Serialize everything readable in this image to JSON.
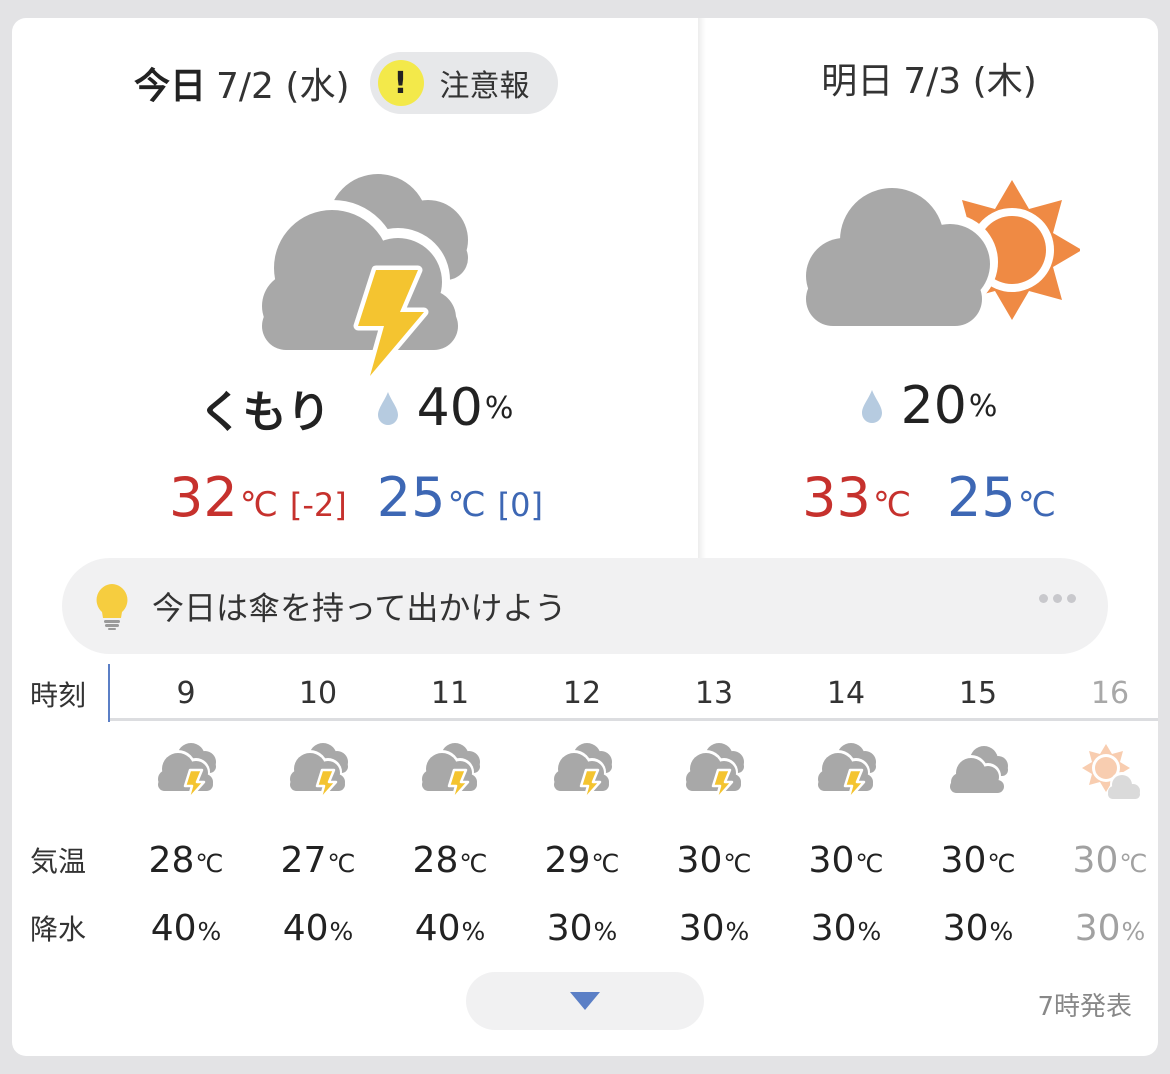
{
  "today": {
    "label": "今日",
    "date": "7/2 (水)",
    "warning_label": "注意報",
    "warning_icon": "!",
    "condition": "くもり",
    "precip_value": "40",
    "precip_unit": "%",
    "high": "32",
    "high_unit": "℃",
    "high_diff": "[-2]",
    "low": "25",
    "low_unit": "℃",
    "low_diff": "[0]",
    "icon": "cloud-thunder-icon"
  },
  "tomorrow": {
    "label": "明日",
    "date": "7/3 (木)",
    "precip_value": "20",
    "precip_unit": "%",
    "high": "33",
    "high_unit": "℃",
    "low": "25",
    "low_unit": "℃",
    "icon": "cloud-sun-icon"
  },
  "tip": {
    "text": "今日は傘を持って出かけよう",
    "icon": "lightbulb-icon"
  },
  "hourly": {
    "time_label": "時刻",
    "temp_label": "気温",
    "precip_label": "降水",
    "temp_unit": "℃",
    "precip_unit": "%",
    "hours": [
      {
        "time": "9",
        "icon": "cloud-thunder",
        "temp": "28",
        "precip": "40"
      },
      {
        "time": "10",
        "icon": "cloud-thunder",
        "temp": "27",
        "precip": "40"
      },
      {
        "time": "11",
        "icon": "cloud-thunder",
        "temp": "28",
        "precip": "40"
      },
      {
        "time": "12",
        "icon": "cloud-thunder",
        "temp": "29",
        "precip": "30"
      },
      {
        "time": "13",
        "icon": "cloud-thunder",
        "temp": "30",
        "precip": "30"
      },
      {
        "time": "14",
        "icon": "cloud-thunder",
        "temp": "30",
        "precip": "30"
      },
      {
        "time": "15",
        "icon": "cloud",
        "temp": "30",
        "precip": "30"
      },
      {
        "time": "16",
        "icon": "sun-cloud",
        "temp": "30",
        "precip": "30"
      }
    ]
  },
  "footer": {
    "expand_icon": "chevron-down-icon",
    "issued": "7時発表"
  },
  "colors": {
    "high": "#c6312d",
    "low": "#3d67b4",
    "cloud": "#a8a8a8",
    "sun": "#ef8a44",
    "bolt": "#f4c430",
    "warning": "#f3e94a",
    "drop": "#b6cbe0",
    "accent": "#5b7fc6"
  }
}
